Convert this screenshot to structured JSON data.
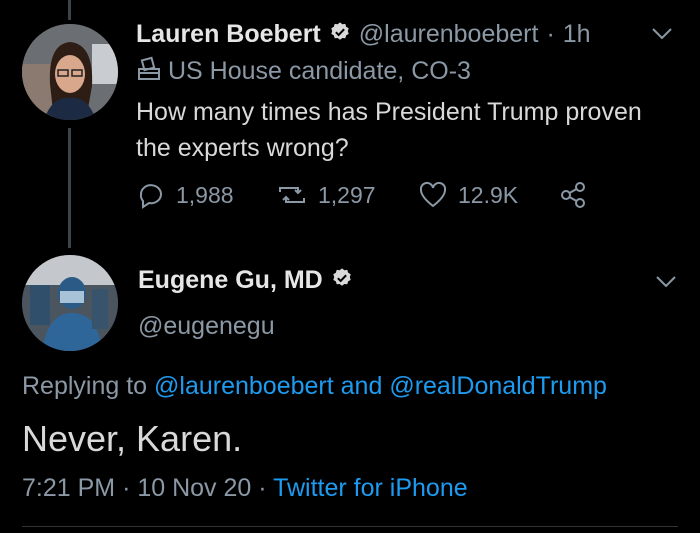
{
  "tweet1": {
    "name": "Lauren Boebert",
    "handle": "@laurenboebert",
    "separator": "·",
    "time": "1h",
    "label": "US House candidate, CO-3",
    "text_line1": "How many times has President Trump proven",
    "text_line2": "the experts wrong?",
    "replies": "1,988",
    "retweets": "1,297",
    "likes": "12.9K"
  },
  "tweet2": {
    "name": "Eugene Gu, MD",
    "handle": "@eugenegu",
    "replying_prefix": "Replying to",
    "replying_user1": "@laurenboebert",
    "replying_and": "and",
    "replying_user2": "@realDonaldTrump",
    "text": "Never, Karen.",
    "time": "7:21 PM",
    "dot1": "·",
    "date": "10 Nov 20",
    "dot2": "·",
    "source": "Twitter for iPhone"
  },
  "colors": {
    "background": "#000000",
    "text": "#d9d9d9",
    "muted": "#8b98a5",
    "link": "#1d9bf0",
    "verified_badge": "#d9d9d9"
  },
  "icons": [
    "verified-badge-icon",
    "chevron-down-icon",
    "ballot-box-icon",
    "reply-icon",
    "retweet-icon",
    "like-icon",
    "share-icon"
  ]
}
